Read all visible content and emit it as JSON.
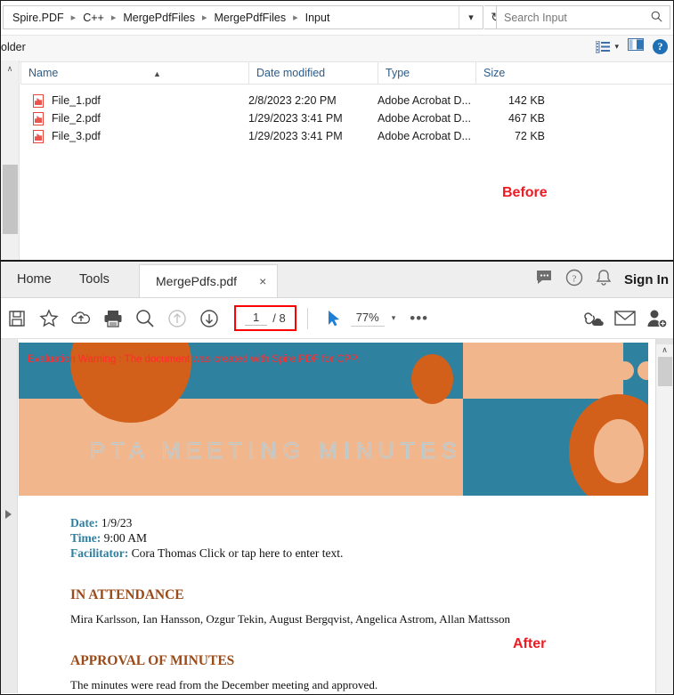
{
  "explorer": {
    "breadcrumbs": [
      "Spire.PDF",
      "C++",
      "MergePdfFiles",
      "MergePdfFiles",
      "Input"
    ],
    "address_chevron": "chevron-down",
    "refresh_glyph": "↻",
    "search": {
      "placeholder": "Search Input",
      "icon": "search-icon"
    },
    "toolbar": {
      "folder_label": "older",
      "view_options_icon": "view-options-icon",
      "view_caret": "▾",
      "preview_pane_icon": "preview-pane-icon",
      "help_label": "?"
    },
    "columns": [
      {
        "label": "Name",
        "sorted": true
      },
      {
        "label": "Date modified",
        "sorted": false
      },
      {
        "label": "Type",
        "sorted": false
      },
      {
        "label": "Size",
        "sorted": false
      }
    ],
    "files": [
      {
        "name": "File_1.pdf",
        "date": "2/8/2023 2:20 PM",
        "type": "Adobe Acrobat D...",
        "size": "142 KB"
      },
      {
        "name": "File_2.pdf",
        "date": "1/29/2023 3:41 PM",
        "type": "Adobe Acrobat D...",
        "size": "467 KB"
      },
      {
        "name": "File_3.pdf",
        "date": "1/29/2023 3:41 PM",
        "type": "Adobe Acrobat D...",
        "size": "72 KB"
      }
    ],
    "scroll_up_glyph": "∧"
  },
  "annotations": {
    "before": "Before",
    "after": "After",
    "accent_color": "#ed1c24"
  },
  "reader": {
    "menu_tabs": [
      {
        "label": "Home"
      },
      {
        "label": "Tools"
      }
    ],
    "document_tab": {
      "name": "MergePdfs.pdf",
      "close_glyph": "×"
    },
    "right_icons": [
      {
        "name": "comment-icon"
      },
      {
        "name": "help-icon"
      },
      {
        "name": "bell-icon"
      }
    ],
    "sign_in": "Sign In",
    "toolbar": {
      "left_icons": [
        {
          "name": "save-icon"
        },
        {
          "name": "star-icon"
        },
        {
          "name": "upload-cloud-icon"
        },
        {
          "name": "print-icon"
        },
        {
          "name": "zoom-search-icon"
        },
        {
          "name": "previous-page-icon"
        },
        {
          "name": "next-page-icon"
        }
      ],
      "page_current": "1",
      "page_total": "/ 8",
      "select-tool": "cursor-arrow-icon",
      "zoom_level": "77%",
      "zoom_caret": "▾",
      "more_glyph": "•••",
      "right_icons": [
        {
          "name": "share-link-icon"
        },
        {
          "name": "email-icon"
        },
        {
          "name": "add-person-icon"
        }
      ]
    },
    "scroll_up_glyph": "∧",
    "expand_pane_icon": "expand-pane-triangle"
  },
  "document": {
    "evaluation_warning": "Evaluation Warning : The document was created with Spire.PDF for CPP.",
    "title": "PTA MEETING MINUTES",
    "meta": [
      {
        "key": "Date:",
        "value": "1/9/23"
      },
      {
        "key": "Time:",
        "value": "9:00 AM"
      },
      {
        "key": "Facilitator:",
        "value": "Cora Thomas Click or tap here to enter text."
      }
    ],
    "sections": [
      {
        "heading": "IN ATTENDANCE",
        "body": "Mira Karlsson, Ian Hansson, Ozgur Tekin, August Bergqvist, Angelica Astrom, Allan Mattsson"
      },
      {
        "heading": "APPROVAL OF MINUTES",
        "body": "The minutes were read from the December meeting and approved."
      }
    ],
    "palette": {
      "teal": "#2E82A0",
      "peach": "#F2B68C",
      "orange": "#D2601A",
      "heading": "#9B4A18",
      "label": "#2E7FA0",
      "warning": "#ff2b2b"
    }
  }
}
